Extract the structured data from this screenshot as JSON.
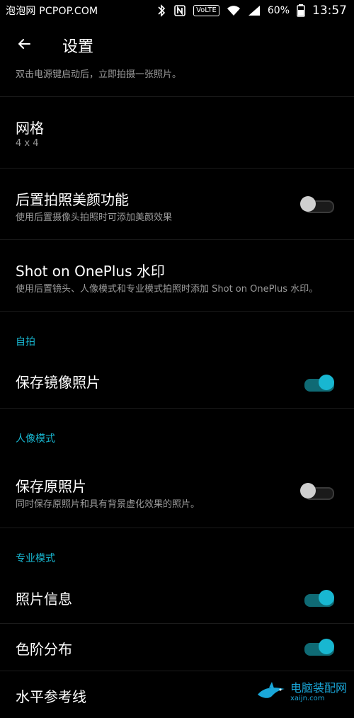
{
  "status_bar": {
    "left_text": "泡泡网 PCPOP.COM",
    "battery_percent": "60%",
    "time": "13:57",
    "icons": [
      "bluetooth-icon",
      "nfc-icon",
      "volte-icon",
      "wifi-icon",
      "signal-icon",
      "battery-icon"
    ],
    "volte_label": "VoLTE"
  },
  "header": {
    "title": "设置",
    "back_icon": "back-arrow-icon"
  },
  "rows": [
    {
      "key": "double_tap_subtitle",
      "subtitle": "双击电源键启动后，立即拍摄一张照片。"
    },
    {
      "key": "grid",
      "title": "网格",
      "subtitle": "4 x 4"
    },
    {
      "key": "rear_beauty",
      "title": "后置拍照美颜功能",
      "subtitle": "使用后置摄像头拍照时可添加美颜效果",
      "toggle": "off"
    },
    {
      "key": "shot_on_oneplus",
      "title": "Shot on OnePlus 水印",
      "subtitle": "使用后置镜头、人像模式和专业模式拍照时添加 Shot on OnePlus 水印。"
    },
    {
      "key": "selfie_section",
      "section": "自拍"
    },
    {
      "key": "save_mirrored",
      "title": "保存镜像照片",
      "toggle": "on"
    },
    {
      "key": "portrait_section",
      "section": "人像模式"
    },
    {
      "key": "save_original",
      "title": "保存原照片",
      "subtitle": "同时保存原照片和具有背景虚化效果的照片。",
      "toggle": "off"
    },
    {
      "key": "pro_section",
      "section": "专业模式"
    },
    {
      "key": "photo_info",
      "title": "照片信息",
      "toggle": "on"
    },
    {
      "key": "histogram",
      "title": "色阶分布",
      "toggle": "on"
    },
    {
      "key": "horizon",
      "title": "水平参考线"
    }
  ],
  "watermark": {
    "line1": "电脑装配网",
    "line2": "xaijn.com"
  },
  "colors": {
    "accent": "#18b7d1",
    "background": "#000000",
    "divider": "#1b1b1b",
    "subtitle": "#9a9a9a"
  }
}
